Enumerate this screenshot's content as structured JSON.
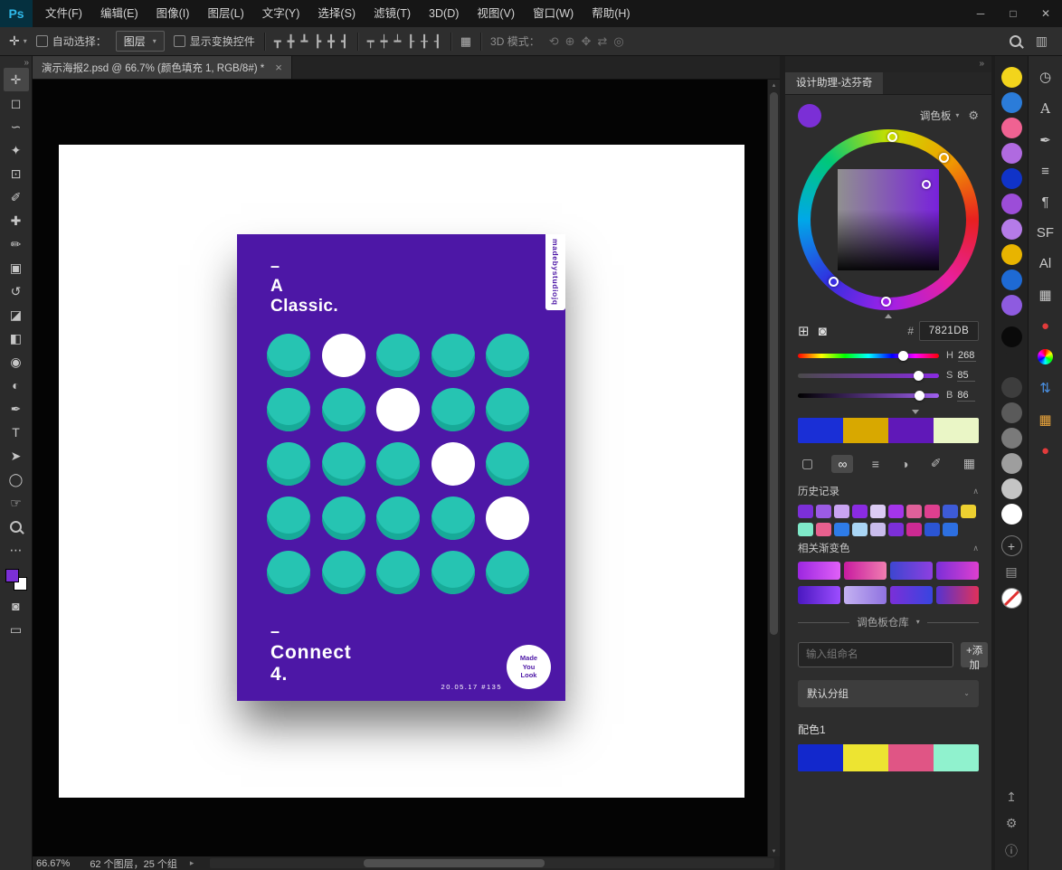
{
  "titlebar": {
    "logo": "Ps",
    "menu_items": [
      "文件(F)",
      "编辑(E)",
      "图像(I)",
      "图层(L)",
      "文字(Y)",
      "选择(S)",
      "滤镜(T)",
      "3D(D)",
      "视图(V)",
      "窗口(W)",
      "帮助(H)"
    ],
    "window_buttons": [
      {
        "name": "minimize-button",
        "glyph": "─"
      },
      {
        "name": "maximize-button",
        "glyph": "□"
      },
      {
        "name": "close-button",
        "glyph": "✕"
      }
    ]
  },
  "options_bar": {
    "tool_chip": "✛",
    "chip_caret": "▾",
    "auto_select_label": "自动选择：",
    "auto_select_value": "图层",
    "select_caret": "▾",
    "show_transform_label": "显示变换控件",
    "align_icons": [
      {
        "name": "align-top-icon",
        "glyph": "┳"
      },
      {
        "name": "align-vcenter-icon",
        "glyph": "╋"
      },
      {
        "name": "align-bottom-icon",
        "glyph": "┻"
      },
      {
        "name": "align-left-icon",
        "glyph": "┣"
      },
      {
        "name": "align-hcenter-icon",
        "glyph": "╋"
      },
      {
        "name": "align-right-icon",
        "glyph": "┫"
      }
    ],
    "distribute_icons": [
      {
        "name": "distribute-top-icon",
        "glyph": "┯"
      },
      {
        "name": "distribute-vcenter-icon",
        "glyph": "┿"
      },
      {
        "name": "distribute-bottom-icon",
        "glyph": "┷"
      },
      {
        "name": "distribute-left-icon",
        "glyph": "┠"
      },
      {
        "name": "distribute-hcenter-icon",
        "glyph": "╂"
      },
      {
        "name": "distribute-right-icon",
        "glyph": "┨"
      }
    ],
    "extra_icons": [
      {
        "name": "distribute-spacing-icon",
        "glyph": "▦"
      }
    ],
    "mode_3d_label": "3D 模式：",
    "mode_3d_icons": [
      {
        "name": "3d-rotate-icon",
        "glyph": "⟲"
      },
      {
        "name": "3d-roll-icon",
        "glyph": "⊕"
      },
      {
        "name": "3d-pan-icon",
        "glyph": "✥"
      },
      {
        "name": "3d-slide-icon",
        "glyph": "⇄"
      },
      {
        "name": "3d-scale-icon",
        "glyph": "◎"
      }
    ],
    "panel_toggle_icon": "▥"
  },
  "doc_tab": {
    "title": "演示海报2.psd @ 66.7% (颜色填充 1, RGB/8#) *",
    "close_icon": "×"
  },
  "toolbar": {
    "rail_hint": "»",
    "tools": [
      {
        "name": "move-tool",
        "glyph": "✛"
      },
      {
        "name": "marquee-tool",
        "glyph": "◻"
      },
      {
        "name": "lasso-tool",
        "glyph": "∽"
      },
      {
        "name": "magic-wand-tool",
        "glyph": "✦"
      },
      {
        "name": "crop-tool",
        "glyph": "⊡"
      },
      {
        "name": "eyedropper-tool",
        "glyph": "✐"
      },
      {
        "name": "healing-brush-tool",
        "glyph": "✚"
      },
      {
        "name": "brush-tool",
        "glyph": "✏"
      },
      {
        "name": "clone-stamp-tool",
        "glyph": "▣"
      },
      {
        "name": "history-brush-tool",
        "glyph": "↺"
      },
      {
        "name": "eraser-tool",
        "glyph": "◪"
      },
      {
        "name": "gradient-tool",
        "glyph": "◧"
      },
      {
        "name": "blur-tool",
        "glyph": "◉"
      },
      {
        "name": "dodge-tool",
        "glyph": "◐"
      },
      {
        "name": "pen-tool",
        "glyph": "✒"
      },
      {
        "name": "type-tool",
        "glyph": "T"
      },
      {
        "name": "path-select-tool",
        "glyph": "➤"
      },
      {
        "name": "shape-tool",
        "glyph": "◯"
      },
      {
        "name": "hand-tool",
        "glyph": "☞"
      },
      {
        "name": "zoom-tool",
        "glyph": "css-mag"
      }
    ],
    "more_icon": "⋯",
    "quick_mask_icon": "◙",
    "screen_mode_icon": "▭",
    "background_color": "#ffffff"
  },
  "poster": {
    "dash_top": "–",
    "title_lines": [
      "A",
      "Classic."
    ],
    "side_text": "madebystudiojq",
    "dash_bottom": "–",
    "footer_lines": [
      "Connect",
      "4."
    ],
    "date_text": "20.05.17  #135",
    "badge_lines": [
      "Made",
      "You",
      "Look"
    ],
    "grid": [
      [
        0,
        1,
        0,
        0,
        0
      ],
      [
        0,
        0,
        1,
        0,
        0
      ],
      [
        0,
        0,
        0,
        1,
        0
      ],
      [
        0,
        0,
        0,
        0,
        1
      ],
      [
        0,
        0,
        0,
        0,
        0
      ]
    ],
    "colors": {
      "background": "#4D17A6",
      "dot": "#26C4B2",
      "dot_shade": "#17AA98",
      "accent_white": "#ffffff"
    }
  },
  "panel": {
    "rail_hint": "»",
    "title": "设计助理-达芬奇",
    "palette_label": "调色板",
    "palette_caret": "▾",
    "gear_icon": "⚙",
    "current_color": "#7B2FD6",
    "grid_icon": "⊞",
    "ring_icon": "◙",
    "hex_label": "#",
    "hex_value": "7821DB",
    "hsb": {
      "h_label": "H",
      "h": "268",
      "s_label": "S",
      "s": "85",
      "b_label": "B",
      "b": "86"
    },
    "quad_bar": [
      "#1A2FD6",
      "#D8A800",
      "#6018B8",
      "#EAF6C6"
    ],
    "tool_icons": [
      {
        "name": "fill-swatch-icon",
        "glyph": "▢"
      },
      {
        "name": "link-icon",
        "glyph": "∞",
        "active": true
      },
      {
        "name": "sliders-icon",
        "glyph": "≡"
      },
      {
        "name": "contrast-icon",
        "glyph": "◑"
      },
      {
        "name": "eyedropper-icon",
        "glyph": "✐"
      },
      {
        "name": "image-icon",
        "glyph": "▦"
      }
    ],
    "history": {
      "label": "历史记录",
      "collapse": "∧",
      "row1": [
        "#7C2FD8",
        "#9B5BE4",
        "#C9A4F2",
        "#8A2BE2",
        "#DCCCF4",
        "#A435EA",
        "#E0609A",
        "#DE3F8F",
        "#3D5BD8",
        "#EDD030"
      ],
      "row2": [
        "#7FE9C9",
        "#E8608E",
        "#2E7CE8",
        "#A9D6F5",
        "#C9BCEC",
        "#7C2FD8",
        "#CD2A93",
        "#2B55D4",
        "#2D6FE0"
      ]
    },
    "gradients": {
      "label": "相关渐变色",
      "collapse": "∧",
      "row1": [
        [
          "#9C27E0",
          "#E060F8"
        ],
        [
          "#C81BA0",
          "#F07EB0"
        ],
        [
          "#3D46D0",
          "#8E3FE0"
        ],
        [
          "#7B2FD8",
          "#DE3FD0"
        ]
      ],
      "row2": [
        [
          "#4A18C0",
          "#9C4DFF"
        ],
        [
          "#C4B2F2",
          "#8F72E0"
        ],
        [
          "#7B2FD8",
          "#3845E0"
        ],
        [
          "#5533D0",
          "#E0315A"
        ]
      ]
    },
    "warehouse": {
      "label": "调色板仓库",
      "caret": "▾"
    },
    "group_input_placeholder": "输入组命名",
    "add_button": "+添加",
    "default_group": "默认分组",
    "dropdown_caret": "⌄",
    "scheme_label": "配色1",
    "scheme_bar": [
      "#1228CC",
      "#EDE431",
      "#E05585",
      "#90F2CE"
    ]
  },
  "status": {
    "zoom": "66.67%",
    "info": "62 个图层，25 个组",
    "chevron": "▸"
  },
  "scrollbar": {
    "up": "▴",
    "down": "▾"
  },
  "right_rail": {
    "color_swatches": [
      "#F2D41C",
      "#2B7CD9",
      "#F06292",
      "#B06AE0",
      "#1033C8",
      "#9C4DD8",
      "#B57BE8",
      "#E8B400",
      "#1E6AD4",
      "#8E5BE0"
    ],
    "gray_swatches": [
      "#0a0a0a",
      "#222222",
      "#3d3d3d",
      "#5a5a5a",
      "#7a7a7a",
      "#9e9e9e",
      "#c4c4c4",
      "#ffffff"
    ],
    "add_icon": "+",
    "layers_icon": "▤",
    "bottom_icons": [
      {
        "name": "upload-icon",
        "glyph": "↥"
      },
      {
        "name": "settings-gear-icon",
        "glyph": "⚙"
      },
      {
        "name": "info-icon",
        "glyph": "ⓘ"
      }
    ],
    "panel_icons": [
      {
        "name": "history-panel-icon",
        "glyph": "◷",
        "color": "#c8c8c8"
      },
      {
        "name": "character-styles-icon",
        "glyph": "A",
        "color": "#c8c8c8",
        "serif": true
      },
      {
        "name": "brushes-icon",
        "glyph": "✒",
        "color": "#c8c8c8"
      },
      {
        "name": "tool-presets-icon",
        "glyph": "≡",
        "color": "#c8c8c8"
      },
      {
        "name": "paragraph-icon",
        "glyph": "¶",
        "color": "#c8c8c8"
      },
      {
        "name": "glyphs-panel-icon",
        "glyph": "SF",
        "color": "#c8c8c8"
      },
      {
        "name": "ai-panel-icon",
        "glyph": "Al",
        "color": "#c8c8c8"
      },
      {
        "name": "pattern-panel-icon",
        "glyph": "▦",
        "color": "#c8c8c8"
      },
      {
        "name": "red-plugin-icon",
        "glyph": "●",
        "color": "#E23B3B"
      },
      {
        "name": "color-wheel-icon",
        "glyph": "conic"
      },
      {
        "name": "sync-arrows-icon",
        "glyph": "⇅",
        "color": "#4A90E2"
      },
      {
        "name": "mosaic-plugin-icon",
        "glyph": "▦",
        "color": "#E8A33B"
      },
      {
        "name": "red-record-icon",
        "glyph": "●",
        "color": "#E23B3B"
      }
    ]
  }
}
